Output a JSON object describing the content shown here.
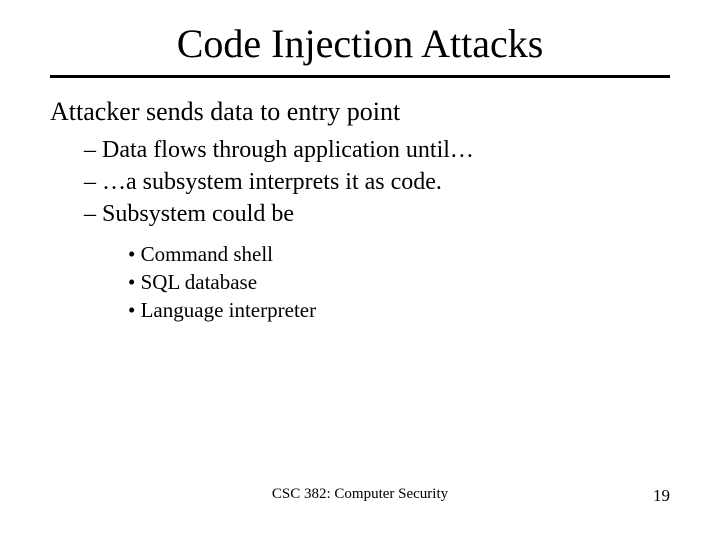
{
  "title": "Code Injection Attacks",
  "main_point": "Attacker sends data to entry point",
  "sub_points": {
    "s1": "– Data flows through application until…",
    "s2": "– …a subsystem interprets it as code.",
    "s3": "– Subsystem could be"
  },
  "bullet_points": {
    "b1": "• Command shell",
    "b2": "• SQL database",
    "b3": "• Language interpreter"
  },
  "footer": {
    "course": "CSC 382: Computer Security",
    "page": "19"
  }
}
